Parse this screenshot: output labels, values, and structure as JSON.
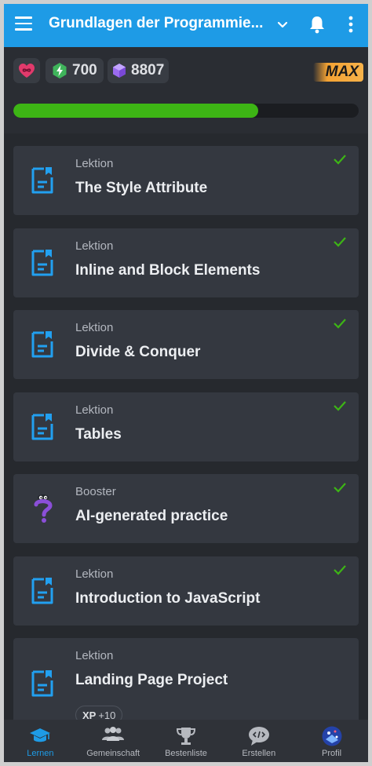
{
  "appbar": {
    "title": "Grundlagen der Programmie...",
    "icons": [
      "menu-icon",
      "chevron-down-icon",
      "bell-icon",
      "more-vert-icon"
    ]
  },
  "stats": {
    "heart_icon": "heart-infinity-icon",
    "bolt_value": "700",
    "gem_value": "8807",
    "max_label": "MAX",
    "progress_fraction": 0.71,
    "colors": {
      "progress": "#3db515",
      "accent": "#1e9be6",
      "check": "#3db515"
    }
  },
  "lessons": [
    {
      "type": "Lektion",
      "title": "The Style Attribute",
      "icon": "lesson-doc-icon",
      "completed": true
    },
    {
      "type": "Lektion",
      "title": "Inline and Block Elements",
      "icon": "lesson-doc-icon",
      "completed": true
    },
    {
      "type": "Lektion",
      "title": "Divide & Conquer",
      "icon": "lesson-doc-icon",
      "completed": true
    },
    {
      "type": "Lektion",
      "title": "Tables",
      "icon": "lesson-doc-icon",
      "completed": true
    },
    {
      "type": "Booster",
      "title": "AI-generated practice",
      "icon": "booster-question-icon",
      "completed": true
    },
    {
      "type": "Lektion",
      "title": "Introduction to JavaScript",
      "icon": "lesson-doc-icon",
      "completed": true
    },
    {
      "type": "Lektion",
      "title": "Landing Page Project",
      "icon": "lesson-doc-icon",
      "completed": false,
      "xp_label": "XP",
      "xp_value": "+10"
    }
  ],
  "nav": [
    {
      "label": "Lernen",
      "icon": "graduation-cap-icon",
      "active": true
    },
    {
      "label": "Gemeinschaft",
      "icon": "community-icon",
      "active": false
    },
    {
      "label": "Bestenliste",
      "icon": "trophy-icon",
      "active": false
    },
    {
      "label": "Erstellen",
      "icon": "code-bubble-icon",
      "active": false
    },
    {
      "label": "Profil",
      "icon": "avatar-icon",
      "active": false
    }
  ]
}
